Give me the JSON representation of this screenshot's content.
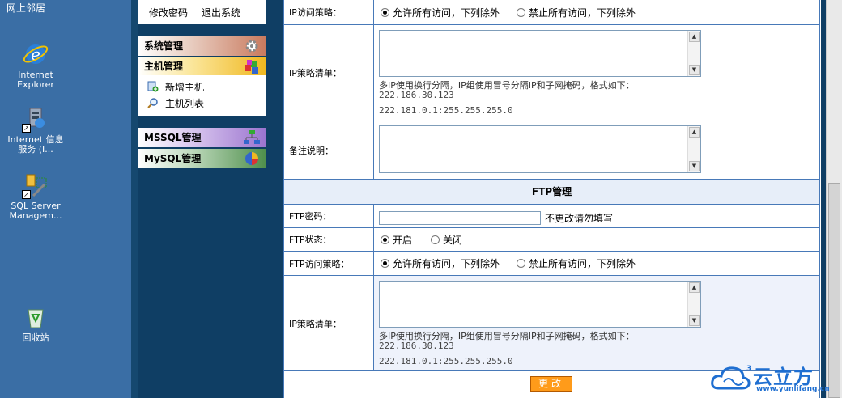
{
  "desktop": {
    "top_label": "网上邻居",
    "icons": [
      {
        "icon": "internet-explorer-icon",
        "label": "Internet Explorer"
      },
      {
        "icon": "iis-icon",
        "label": "Internet 信息服务 (I..."
      },
      {
        "icon": "sql-server-icon",
        "label": "SQL Server Managem..."
      },
      {
        "icon": "recycle-bin-icon",
        "label": "回收站"
      }
    ]
  },
  "sidebar": {
    "change_password": "修改密码",
    "logout": "退出系统",
    "menus": [
      {
        "label": "系统管理",
        "color": "#d8a18a"
      },
      {
        "label": "主机管理",
        "color": "#f2cd5c"
      },
      {
        "label": "MSSQL管理",
        "color": "#b79bd8"
      },
      {
        "label": "MySQL管理",
        "color": "#7fa87d"
      }
    ],
    "sub_items": [
      "新增主机",
      "主机列表"
    ]
  },
  "form": {
    "ip_policy": {
      "label": "IP访问策略：",
      "options": [
        "允许所有访问，下列除外",
        "禁止所有访问，下列除外"
      ],
      "selected": 0
    },
    "ip_list": {
      "label": "IP策略清单：",
      "hint": "多IP使用换行分隔，IP组使用冒号分隔IP和子网掩码，格式如下：",
      "example1": "222.186.30.123",
      "example2": "222.181.0.1:255.255.255.0"
    },
    "note": {
      "label": "备注说明："
    },
    "ftp_section_title": "FTP管理",
    "ftp_password": {
      "label": "FTP密码：",
      "value": "",
      "hint": "不更改请勿填写"
    },
    "ftp_status": {
      "label": "FTP状态：",
      "options": [
        "开启",
        "关闭"
      ],
      "selected": 0
    },
    "ftp_ip_policy": {
      "label": "FTP访问策略：",
      "options": [
        "允许所有访问，下列除外",
        "禁止所有访问，下列除外"
      ],
      "selected": 0
    },
    "ftp_ip_list": {
      "label": "IP策略清单：",
      "hint": "多IP使用换行分隔，IP组使用冒号分隔IP和子网掩码，格式如下：",
      "example1": "222.186.30.123",
      "example2": "222.181.0.1:255.255.255.0"
    },
    "submit_label": "更改"
  },
  "watermark": {
    "brand": "云立方",
    "url": "www.yunlifang.cn",
    "superscript": "3"
  }
}
